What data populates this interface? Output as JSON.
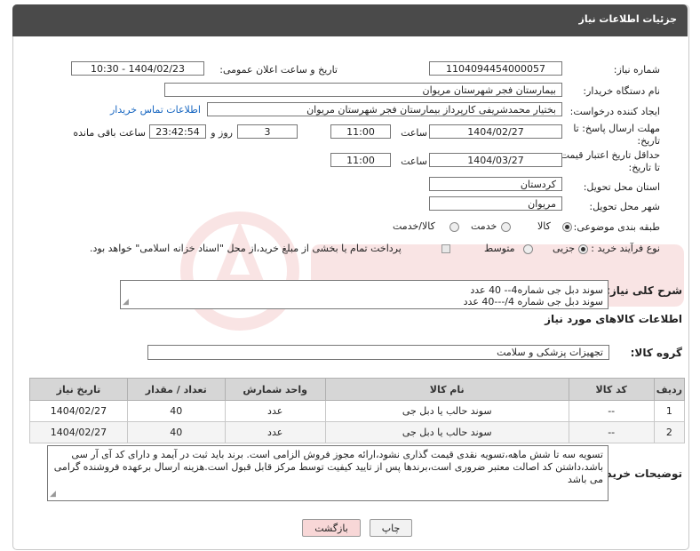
{
  "header": {
    "title": "جزئیات اطلاعات نیاز"
  },
  "form": {
    "need_number_label": "شماره نیاز:",
    "need_number": "1104094454000057",
    "announce_label": "تاریخ و ساعت اعلان عمومی:",
    "announce_value": "1404/02/23 - 10:30",
    "buyer_org_label": "نام دستگاه خریدار:",
    "buyer_org": "بیمارستان فجر شهرستان مریوان",
    "creator_label": "ایجاد کننده درخواست:",
    "creator": "بختیار محمدشریفی کارپرداز بیمارستان فجر شهرستان مریوان",
    "contact_link": "اطلاعات تماس خریدار",
    "deadline_label_1": "مهلت ارسال پاسخ: تا",
    "deadline_label_2": "تاریخ:",
    "deadline_date": "1404/02/27",
    "time_label": "ساعت",
    "deadline_time": "11:00",
    "days_value": "3",
    "days_label": "روز و",
    "remaining_time": "23:42:54",
    "remaining_label": "ساعت باقی مانده",
    "validity_label_1": "حداقل تاریخ اعتبار قیمت:",
    "validity_label_2": "تا تاریخ:",
    "validity_date": "1404/03/27",
    "validity_time": "11:00",
    "province_label": "استان محل تحویل:",
    "province": "کردستان",
    "city_label": "شهر محل تحویل:",
    "city": "مریوان",
    "category_label": "طبقه بندی موضوعی:",
    "category_options": [
      "کالا",
      "خدمت",
      "کالا/خدمت"
    ],
    "category_selected": "کالا",
    "process_label": "نوع فرآیند خرید :",
    "process_options": [
      "جزیی",
      "متوسط"
    ],
    "process_selected": "جزیی",
    "payment_note": "پرداخت تمام یا بخشی از مبلغ خرید،از محل \"اسناد خزانه اسلامی\" خواهد بود."
  },
  "description": {
    "label": "شرح کلی نیاز:",
    "line1": "سوند دبل جی شماره4-- 40 عدد",
    "line2": "سوند دبل جی شماره 4/---40 عدد"
  },
  "goods": {
    "section_title": "اطلاعات کالاهای مورد نیاز",
    "group_label": "گروه کالا:",
    "group_value": "تجهیزات پزشکی و سلامت",
    "columns": [
      "ردیف",
      "کد کالا",
      "نام کالا",
      "واحد شمارش",
      "تعداد / مقدار",
      "تاریخ نیاز"
    ],
    "rows": [
      {
        "row": "1",
        "code": "--",
        "name": "سوند حالب یا دبل جی",
        "unit": "عدد",
        "qty": "40",
        "date": "1404/02/27"
      },
      {
        "row": "2",
        "code": "--",
        "name": "سوند حالب یا دبل جی",
        "unit": "عدد",
        "qty": "40",
        "date": "1404/02/27"
      }
    ]
  },
  "buyer_notes": {
    "label": "توضیحات خریدار:",
    "text": "تسویه سه تا شش ماهه،تسویه نقدی قیمت گذاری نشود،ارائه مجوز فروش الزامی است. برند باید ثبت در آیمد و دارای کد آی آر سی باشد،داشتن کد اصالت معتبر ضروری است،برندها پس از تایید کیفیت توسط مرکز قابل قبول است.هزینه ارسال برعهده فروشنده گرامی می باشد"
  },
  "buttons": {
    "print": "چاپ",
    "back": "بازگشت"
  },
  "colors": {
    "header_bg": "#4a4a4a",
    "link": "#1565c0",
    "back_button_bg": "#f8d7d7",
    "table_header_bg": "#d6d6d6"
  }
}
